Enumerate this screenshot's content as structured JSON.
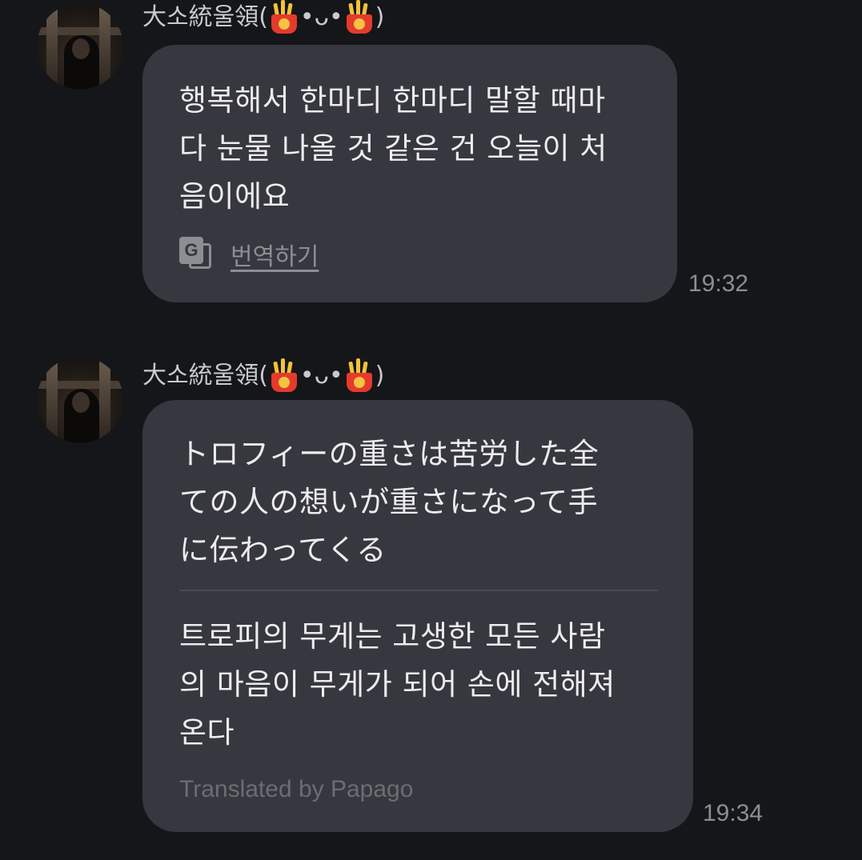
{
  "messages": [
    {
      "sender": {
        "name_prefix": "大소統울領(",
        "face": "•ᴗ•",
        "name_suffix": ")",
        "emoji": "french-fries-icon"
      },
      "text_lines": [
        "행복해서 한마디 한마디 말할 때마",
        "다 눈물 나올 것 같은 건 오늘이 처",
        "음이에요"
      ],
      "translate_label": "번역하기",
      "time": "19:32"
    },
    {
      "sender": {
        "name_prefix": "大소統울領(",
        "face": "•ᴗ•",
        "name_suffix": ")",
        "emoji": "french-fries-icon"
      },
      "original_lines": [
        "トロフィーの重さは苦労した全",
        "ての人の想いが重さになって手",
        "に伝わってくる"
      ],
      "translated_lines": [
        "트로피의 무게는 고생한 모든 사람",
        "의 마음이 무게가 되어 손에 전해져",
        "온다"
      ],
      "credit": "Translated by Papago",
      "time": "19:34"
    }
  ],
  "colors": {
    "background": "#151619",
    "bubble": "#36373f",
    "text": "#ececee",
    "muted": "#8d8e94"
  }
}
